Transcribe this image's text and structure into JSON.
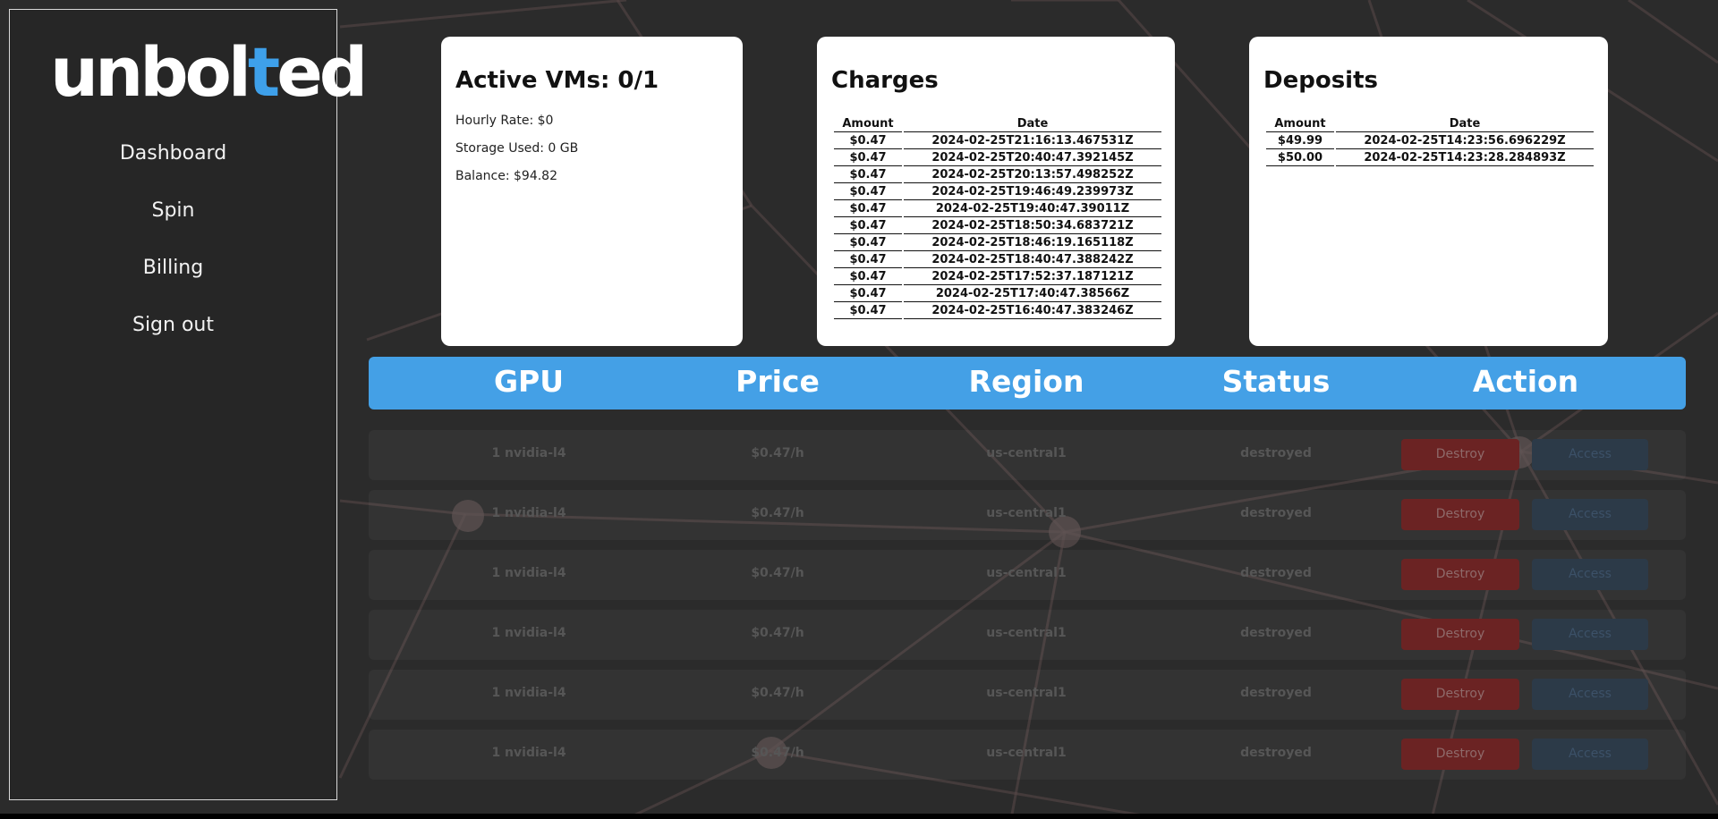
{
  "brand": {
    "logo_main": "unbol",
    "logo_accent": "t",
    "logo_tail": "ed",
    "accent_color": "#3ea0ea"
  },
  "sidebar": {
    "items": [
      {
        "label": "Dashboard"
      },
      {
        "label": "Spin"
      },
      {
        "label": "Billing"
      },
      {
        "label": "Sign out"
      }
    ]
  },
  "vms_card": {
    "title": "Active VMs: 0/1",
    "hourly_rate": "Hourly Rate: $0",
    "storage_used": "Storage Used: 0 GB",
    "balance": "Balance: $94.82"
  },
  "charges_card": {
    "title": "Charges",
    "headers": {
      "amount": "Amount",
      "date": "Date"
    },
    "rows": [
      {
        "amount": "$0.47",
        "date": "2024-02-25T21:16:13.467531Z"
      },
      {
        "amount": "$0.47",
        "date": "2024-02-25T20:40:47.392145Z"
      },
      {
        "amount": "$0.47",
        "date": "2024-02-25T20:13:57.498252Z"
      },
      {
        "amount": "$0.47",
        "date": "2024-02-25T19:46:49.239973Z"
      },
      {
        "amount": "$0.47",
        "date": "2024-02-25T19:40:47.39011Z"
      },
      {
        "amount": "$0.47",
        "date": "2024-02-25T18:50:34.683721Z"
      },
      {
        "amount": "$0.47",
        "date": "2024-02-25T18:46:19.165118Z"
      },
      {
        "amount": "$0.47",
        "date": "2024-02-25T18:40:47.388242Z"
      },
      {
        "amount": "$0.47",
        "date": "2024-02-25T17:52:37.187121Z"
      },
      {
        "amount": "$0.47",
        "date": "2024-02-25T17:40:47.38566Z"
      },
      {
        "amount": "$0.47",
        "date": "2024-02-25T16:40:47.383246Z"
      }
    ]
  },
  "deposits_card": {
    "title": "Deposits",
    "headers": {
      "amount": "Amount",
      "date": "Date"
    },
    "rows": [
      {
        "amount": "$49.99",
        "date": "2024-02-25T14:23:56.696229Z"
      },
      {
        "amount": "$50.00",
        "date": "2024-02-25T14:23:28.284893Z"
      }
    ]
  },
  "vm_table": {
    "headers": {
      "gpu": "GPU",
      "price": "Price",
      "region": "Region",
      "status": "Status",
      "action": "Action"
    },
    "header_color": "#44a0e6",
    "rows": [
      {
        "gpu": "1 nvidia-l4",
        "price": "$0.47/h",
        "region": "us-central1",
        "status": "destroyed",
        "destroy": "Destroy",
        "access": "Access"
      },
      {
        "gpu": "1 nvidia-l4",
        "price": "$0.47/h",
        "region": "us-central1",
        "status": "destroyed",
        "destroy": "Destroy",
        "access": "Access"
      },
      {
        "gpu": "1 nvidia-l4",
        "price": "$0.47/h",
        "region": "us-central1",
        "status": "destroyed",
        "destroy": "Destroy",
        "access": "Access"
      },
      {
        "gpu": "1 nvidia-l4",
        "price": "$0.47/h",
        "region": "us-central1",
        "status": "destroyed",
        "destroy": "Destroy",
        "access": "Access"
      },
      {
        "gpu": "1 nvidia-l4",
        "price": "$0.47/h",
        "region": "us-central1",
        "status": "destroyed",
        "destroy": "Destroy",
        "access": "Access"
      },
      {
        "gpu": "1 nvidia-l4",
        "price": "$0.47/h",
        "region": "us-central1",
        "status": "destroyed",
        "destroy": "Destroy",
        "access": "Access"
      }
    ]
  }
}
